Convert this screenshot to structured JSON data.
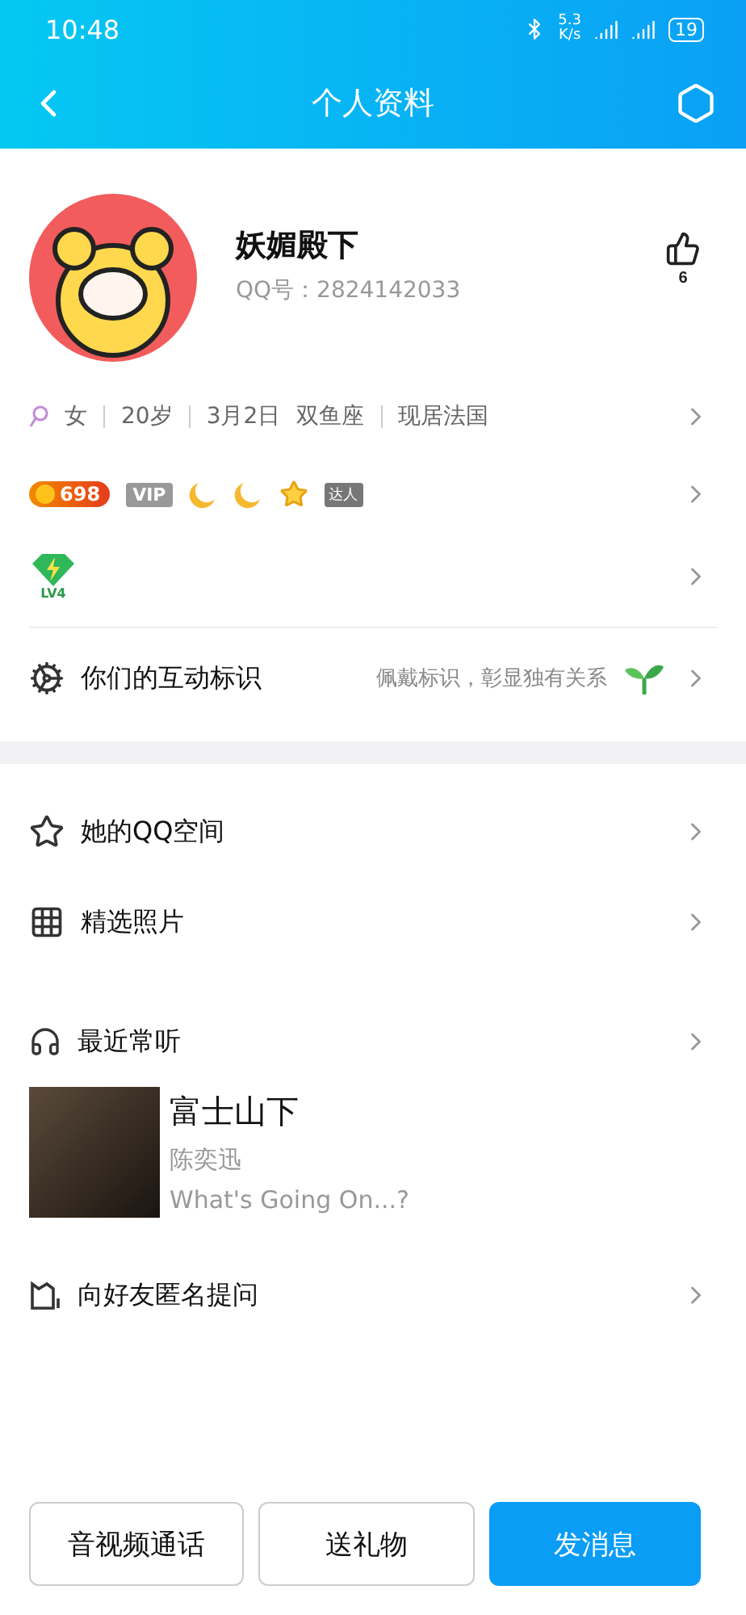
{
  "status_bar": {
    "time": "10:48",
    "speed_value": "5.3",
    "speed_unit": "K/s",
    "battery": "19"
  },
  "nav": {
    "title": "个人资料"
  },
  "profile": {
    "name": "妖媚殿下",
    "qq": "QQ号：2824142033",
    "likes": "6"
  },
  "info": [
    [
      "女"
    ],
    [
      "20岁"
    ],
    [
      "3月2日",
      "双鱼座"
    ],
    [
      "现居法国"
    ]
  ],
  "badges": {
    "coins": "698",
    "vip": "VIP",
    "talent": "达人"
  },
  "level_badge": {
    "label": "LV4"
  },
  "interaction": {
    "label": "你们的互动标识",
    "hint": "佩戴标识，彰显独有关系"
  },
  "menu": [
    {
      "kind": "qzone",
      "label": "她的QQ空间"
    },
    {
      "kind": "photos",
      "label": "精选照片"
    }
  ],
  "music": {
    "label": "最近常听",
    "song": {
      "title": "富士山下",
      "artist": "陈奕迅",
      "album": "What's Going On...?"
    }
  },
  "ask": {
    "label": "向好友匿名提问"
  },
  "actions": [
    {
      "kind": "outline",
      "label": "音视频通话"
    },
    {
      "kind": "outline",
      "label": "送礼物"
    },
    {
      "kind": "primary",
      "label": "发消息"
    }
  ]
}
